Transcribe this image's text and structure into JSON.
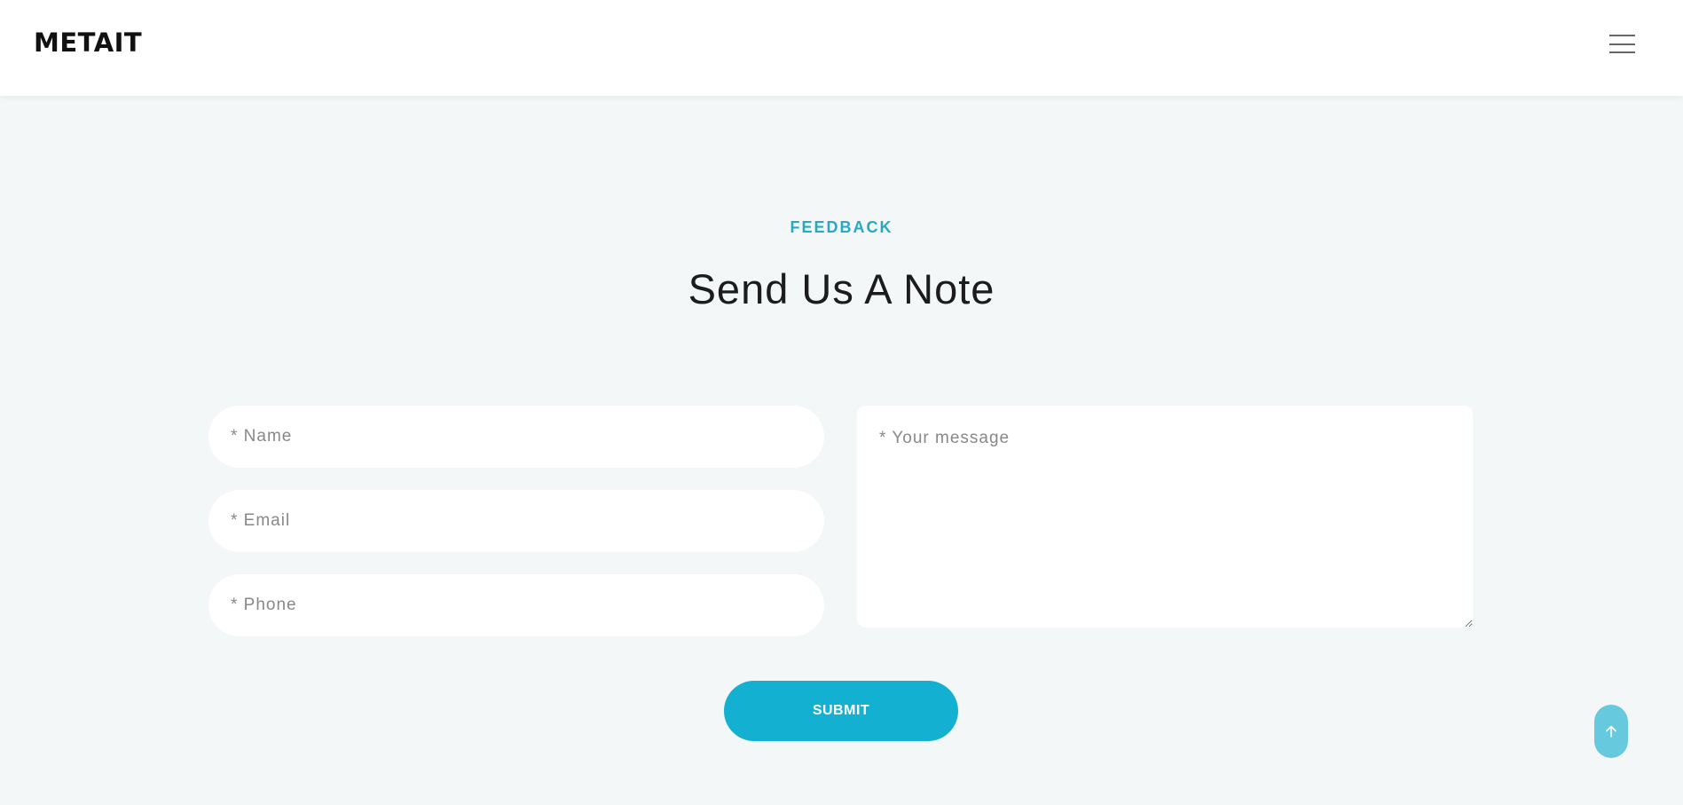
{
  "header": {
    "logo_text": "METAIT",
    "menu_icon": "hamburger-menu-icon"
  },
  "section": {
    "eyebrow": "FEEDBACK",
    "title": "Send Us A Note"
  },
  "form": {
    "name_placeholder": "* Name",
    "email_placeholder": "* Email",
    "phone_placeholder": "* Phone",
    "message_placeholder": "* Your message",
    "submit_label": "SUBMIT"
  },
  "back_to_top_icon": "arrow-up-icon",
  "colors": {
    "accent": "#14b0d1",
    "eyebrow": "#27a9c6",
    "background": "#f3f7f7",
    "back_to_top": "#67c9dd"
  }
}
